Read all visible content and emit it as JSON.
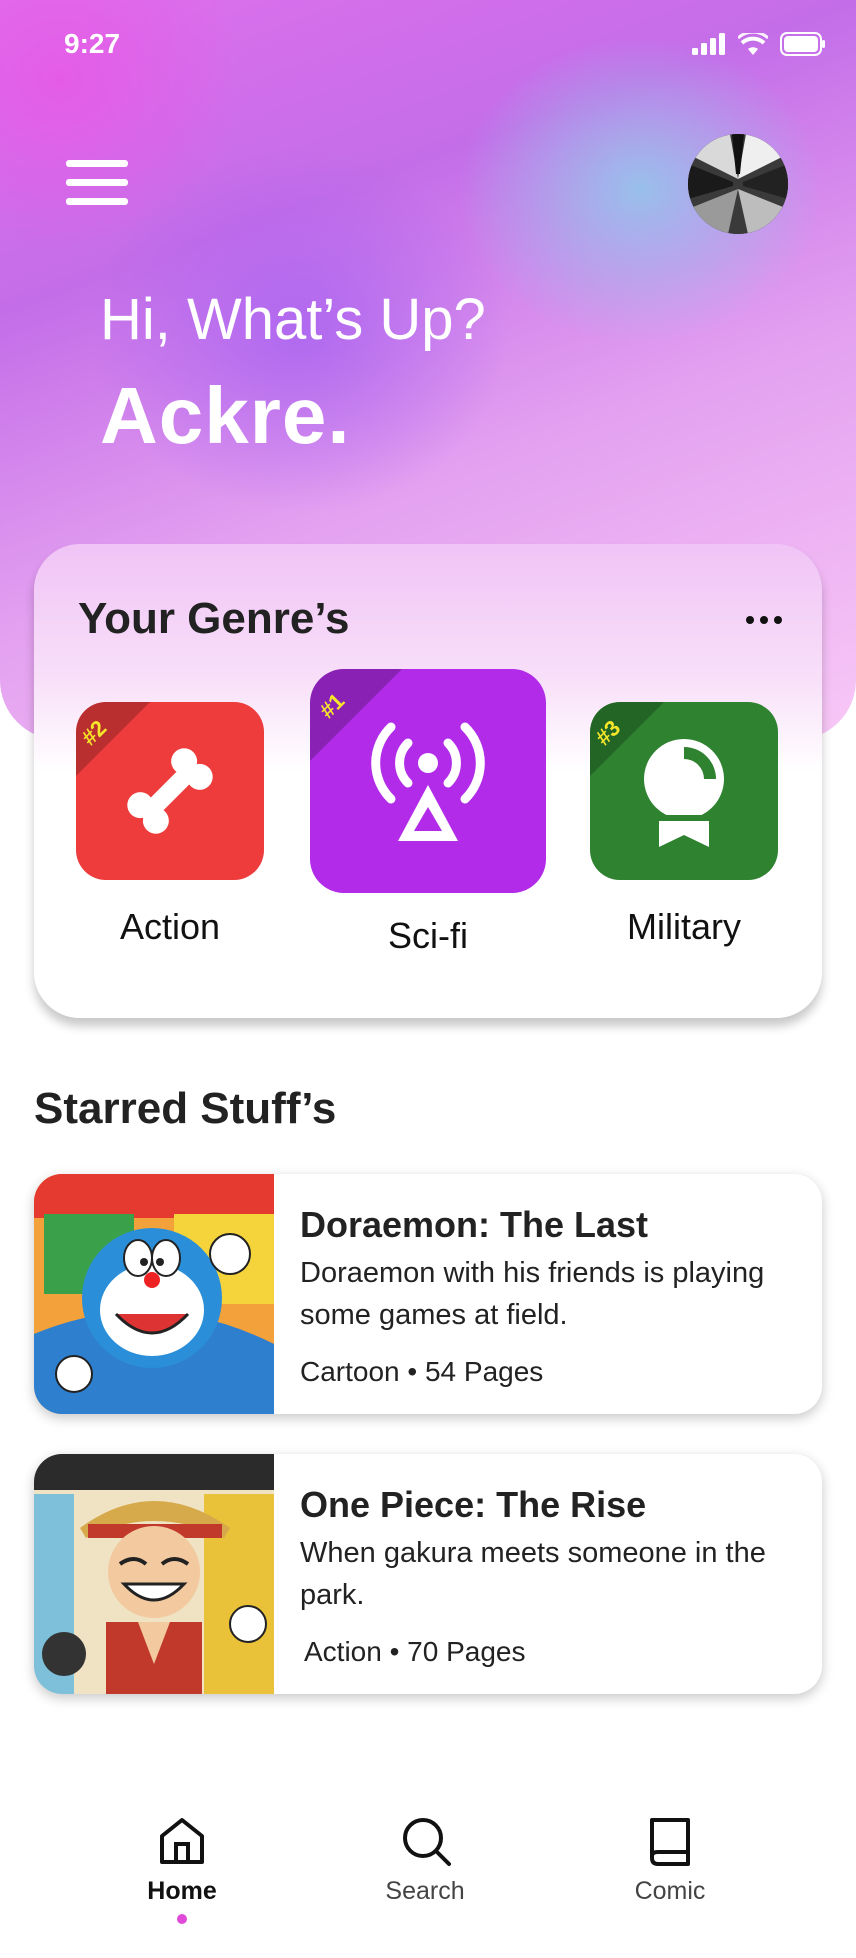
{
  "status_bar": {
    "time": "9:27"
  },
  "header": {
    "greeting": "Hi, What’s Up?",
    "user_name": "Ackre."
  },
  "genres": {
    "title": "Your Genre’s",
    "items": [
      {
        "rank": "#2",
        "label": "Action",
        "color": "#ee3b3b",
        "icon": "bone-icon"
      },
      {
        "rank": "#1",
        "label": "Sci-fi",
        "color": "#b12be8",
        "icon": "antenna-icon"
      },
      {
        "rank": "#3",
        "label": "Military",
        "color": "#2e8230",
        "icon": "medal-icon"
      }
    ]
  },
  "starred": {
    "title": "Starred Stuff’s",
    "items": [
      {
        "title": "Doraemon: The Last",
        "description": "Doraemon with his friends is playing some games at field.",
        "meta": "Cartoon • 54 Pages"
      },
      {
        "title": "One Piece: The Rise",
        "description": "When gakura meets someone in the park.",
        "meta": "Action • 70 Pages"
      }
    ]
  },
  "nav": {
    "items": [
      {
        "label": "Home",
        "icon": "home-icon",
        "active": true
      },
      {
        "label": "Search",
        "icon": "search-icon",
        "active": false
      },
      {
        "label": "Comic",
        "icon": "book-icon",
        "active": false
      }
    ]
  },
  "colors": {
    "accent": "#e04ad8",
    "rank_text": "#f5e62a"
  }
}
